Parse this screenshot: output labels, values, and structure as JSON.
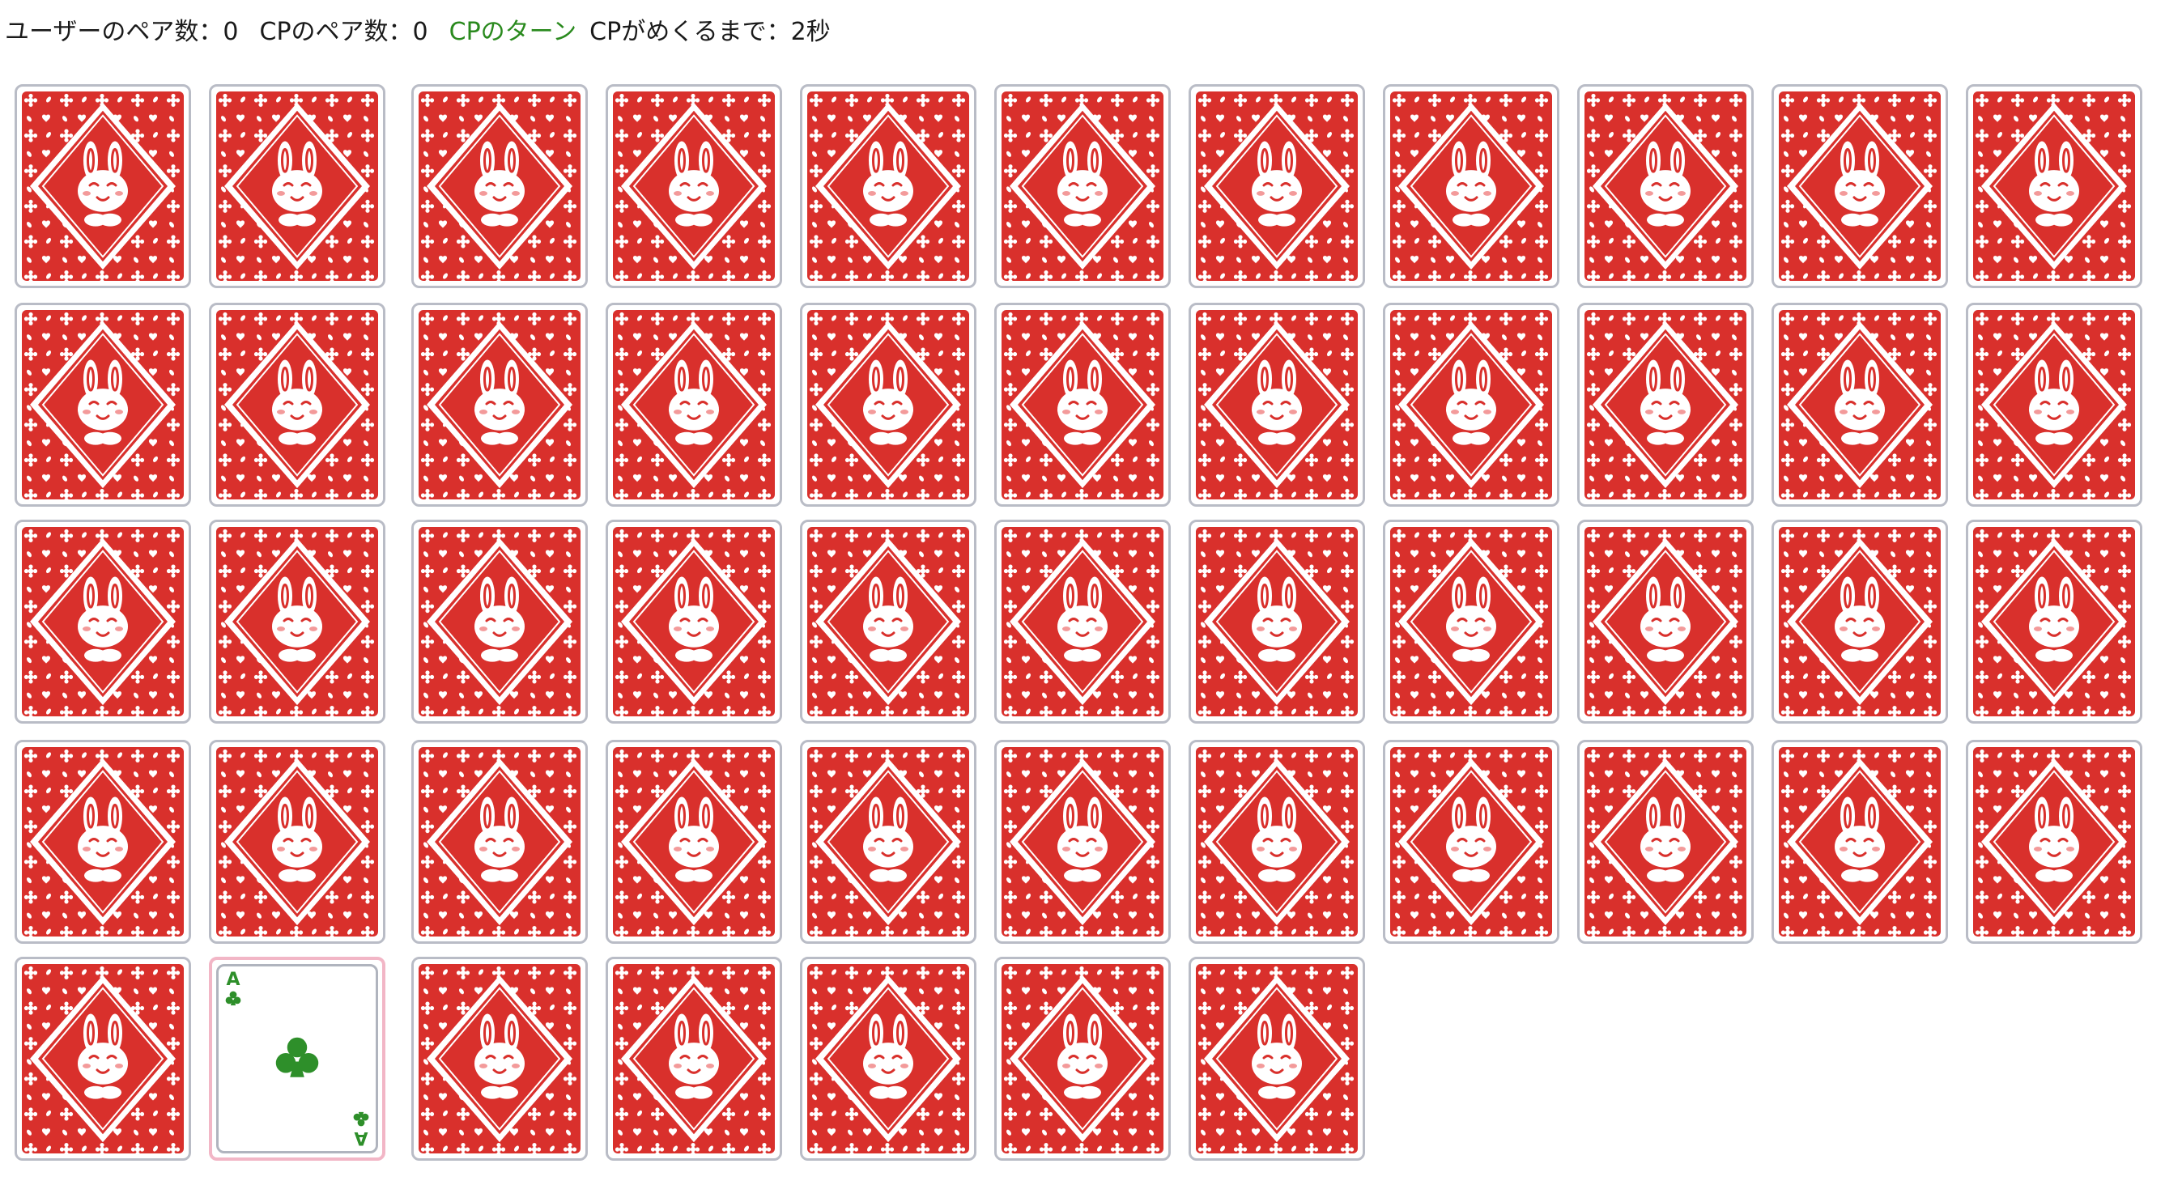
{
  "status": {
    "user_pairs": "ユーザーのペア数：0",
    "cp_pairs": "CPのペア数：0",
    "turn": "CPのターン",
    "countdown": "CPがめくるまで：2秒"
  },
  "colors": {
    "turn_text": "#2a8a1e",
    "card_back_red": "#d9302c",
    "card_border": "#b9bcc6",
    "selected_border": "#f2b6c6",
    "suit_green": "#2e8f2a"
  },
  "board": {
    "rows": 5,
    "columns": 11,
    "card_count": 51,
    "face_up_cards": [
      {
        "index": 45,
        "rank": "A",
        "suit": "club",
        "suit_icon": "club-icon"
      }
    ],
    "back_icon": "bunny-card-back-icon"
  }
}
